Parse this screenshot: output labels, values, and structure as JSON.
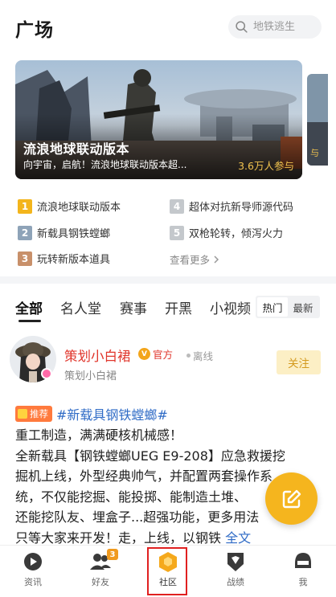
{
  "header": {
    "title": "广场",
    "search_placeholder": "地铁逃生"
  },
  "banner": {
    "title": "流浪地球联动版本",
    "subtitle": "向宇宙，启航！流浪地球联动版本超...",
    "participants": "3.6万人参与",
    "next_peek_text": "与"
  },
  "hot_list": {
    "items": [
      {
        "rank": "1",
        "text": "流浪地球联动版本",
        "color": "#f3b51c"
      },
      {
        "rank": "2",
        "text": "新载具钢铁螳螂",
        "color": "#8ea3b8"
      },
      {
        "rank": "3",
        "text": "玩转新版本道具",
        "color": "#c8906a"
      },
      {
        "rank": "4",
        "text": "超体对抗新导师源代码",
        "color": "#c4c8cc"
      },
      {
        "rank": "5",
        "text": "双枪轮转，倾泻火力",
        "color": "#c4c8cc"
      }
    ],
    "more_label": "查看更多"
  },
  "tabs": {
    "items": [
      "全部",
      "名人堂",
      "赛事",
      "开黑",
      "小视频"
    ],
    "sort": {
      "hot": "热门",
      "latest": "最新"
    }
  },
  "post": {
    "author_name": "策划小白裙",
    "official_label": "官方",
    "official_badge": "V",
    "status": "离线",
    "author_sub": "策划小白裙",
    "follow_label": "关注",
    "recommend_label": "推荐",
    "topic": "#新载具钢铁螳螂#",
    "lines": [
      "重工制造，满满硬核机械感！",
      "全新载具【钢铁螳螂UEG E9-208】应急救援挖",
      "掘机上线，外型经典帅气，并配置两套操作系",
      "统，不仅能挖掘、能投掷、能制造土堆、",
      "还能挖队友、埋盒子...超强功能，更多用法",
      "只等大家来开发！走，上线，以钢铁 "
    ],
    "full_text_label": "全文"
  },
  "bottom_nav": {
    "items": [
      {
        "label": "资讯"
      },
      {
        "label": "好友",
        "badge": "3"
      },
      {
        "label": "社区"
      },
      {
        "label": "战绩"
      },
      {
        "label": "我"
      }
    ]
  },
  "colors": {
    "accent": "#f5b51e",
    "link": "#2f6bc6",
    "author": "#e0352b",
    "highlight_box": "#e02020"
  }
}
